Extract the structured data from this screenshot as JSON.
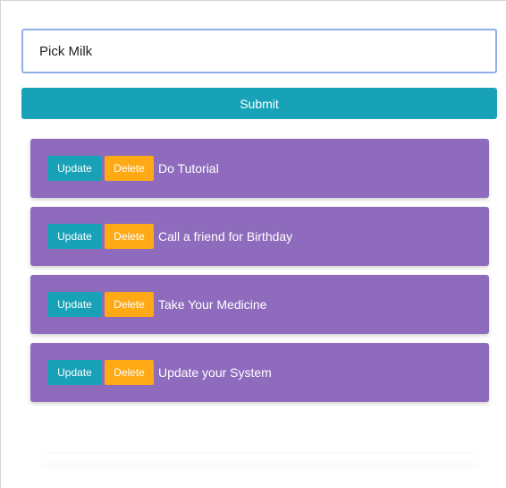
{
  "form": {
    "input_value": "Pick Milk",
    "submit_label": "Submit"
  },
  "colors": {
    "primary": "#17a2b8",
    "warning": "#ffa914",
    "task_background": "#8e6bbd",
    "input_border": "#8fb0e6"
  },
  "tasks": [
    {
      "text": "Do Tutorial",
      "update_label": "Update",
      "delete_label": "Delete"
    },
    {
      "text": "Call a friend for Birthday",
      "update_label": "Update",
      "delete_label": "Delete"
    },
    {
      "text": "Take Your Medicine",
      "update_label": "Update",
      "delete_label": "Delete"
    },
    {
      "text": "Update your System",
      "update_label": "Update",
      "delete_label": "Delete"
    }
  ]
}
